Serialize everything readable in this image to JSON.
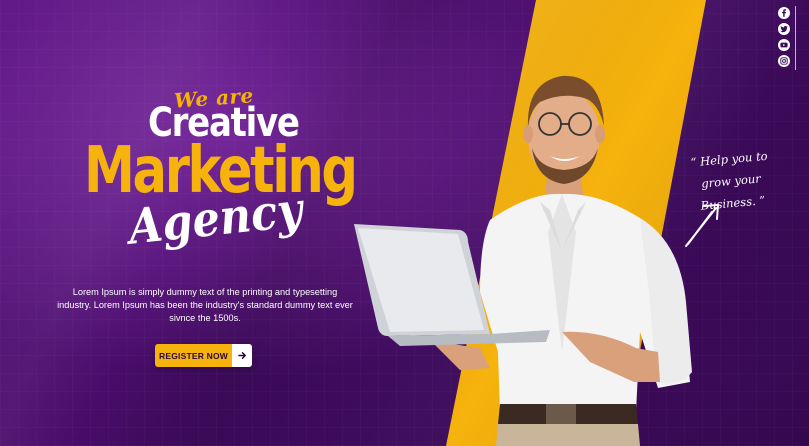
{
  "colors": {
    "background": "#4a0d6c",
    "accent": "#f6b20d",
    "text": "#ffffff"
  },
  "headline": {
    "line1": "We are",
    "line2": "Creative",
    "line3": "Marketing",
    "line4": "Agency"
  },
  "description": "Lorem Ipsum is simply dummy text of the printing and typesetting industry. Lorem Ipsum has been the industry's standard dummy text ever sivnce the 1500s.",
  "cta": {
    "label": "REGISTER NOW",
    "icon": "arrow-right-icon"
  },
  "tagline": "“ Help you to grow your Business. ”",
  "social": {
    "icons": [
      "facebook-icon",
      "twitter-icon",
      "youtube-icon",
      "instagram-icon"
    ]
  }
}
